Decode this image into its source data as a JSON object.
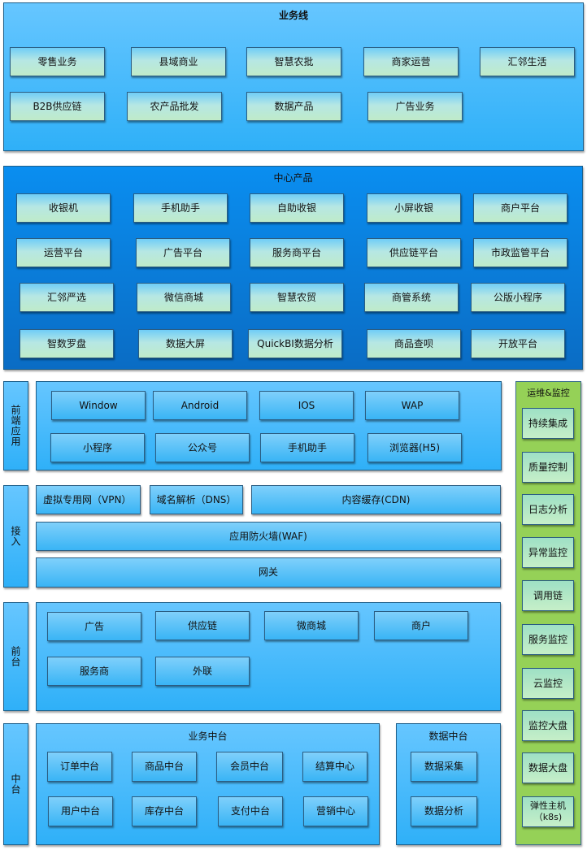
{
  "business_line": {
    "title": "业务线",
    "items": [
      "零售业务",
      "县域商业",
      "智慧农批",
      "商家运营",
      "汇邻生活",
      "B2B供应链",
      "农产品批发",
      "数据产品",
      "广告业务"
    ]
  },
  "center_products": {
    "title": "中心产品",
    "items": [
      "收银机",
      "手机助手",
      "自助收银",
      "小屏收银",
      "商户平台",
      "运营平台",
      "广告平台",
      "服务商平台",
      "供应链平台",
      "市政监管平台",
      "汇邻严选",
      "微信商城",
      "智慧农贸",
      "商管系统",
      "公版小程序",
      "智数罗盘",
      "数据大屏",
      "QuickBI数据分析",
      "商品查呗",
      "开放平台"
    ]
  },
  "frontend": {
    "label": "前端应用",
    "items": [
      "Window",
      "Android",
      "IOS",
      "WAP",
      "小程序",
      "公众号",
      "手机助手",
      "浏览器(H5)"
    ]
  },
  "access": {
    "label": "接入",
    "items": [
      "虚拟专用网（VPN）",
      "域名解析（DNS）",
      "内容缓存(CDN)",
      "应用防火墙(WAF)",
      "网关"
    ]
  },
  "front_office": {
    "label": "前台",
    "items": [
      "广告",
      "供应链",
      "微商城",
      "商户",
      "服务商",
      "外联"
    ]
  },
  "middle_office": {
    "label": "中台",
    "business": {
      "title": "业务中台",
      "items": [
        "订单中台",
        "商品中台",
        "会员中台",
        "结算中心",
        "用户中台",
        "库存中台",
        "支付中台",
        "营销中心"
      ]
    },
    "data": {
      "title": "数据中台",
      "items": [
        "数据采集",
        "数据分析"
      ]
    }
  },
  "ops": {
    "title": "运维&监控",
    "items": [
      "持续集成",
      "质量控制",
      "日志分析",
      "异常监控",
      "调用链",
      "服务监控",
      "云监控",
      "监控大盘",
      "数据大盘",
      "弹性主机（k8s)"
    ]
  }
}
